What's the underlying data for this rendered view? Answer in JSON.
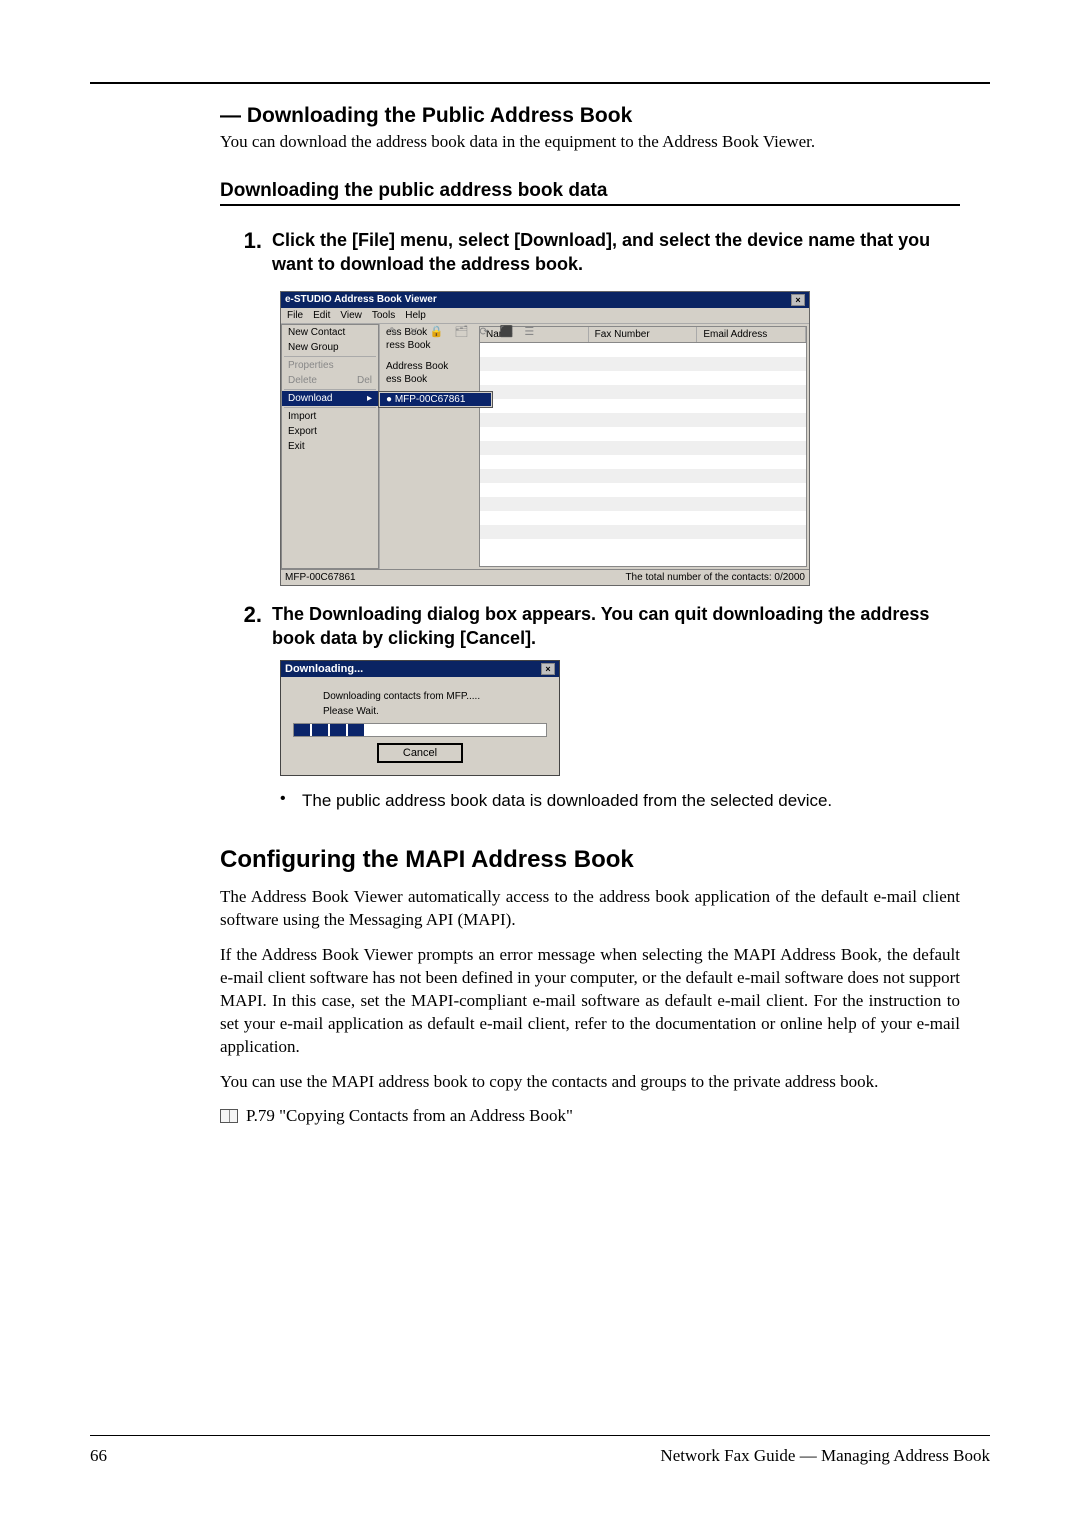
{
  "rule": true,
  "section1": {
    "title": "— Downloading the Public Address Book",
    "intro": "You can download the address book data in the equipment to the Address Book Viewer.",
    "sub": "Downloading the public address book data"
  },
  "steps": {
    "s1": {
      "num": "1.",
      "text": "Click the [File] menu, select [Download], and select the device name that you want to download the address book."
    },
    "s2": {
      "num": "2.",
      "text": "The Downloading dialog box appears.  You can quit downloading the address book data by clicking [Cancel]."
    }
  },
  "appWindow": {
    "title": "e-STUDIO Address Book Viewer",
    "close": "×",
    "menubar": {
      "file": "File",
      "edit": "Edit",
      "view": "View",
      "tools": "Tools",
      "help": "Help"
    },
    "fileMenu": {
      "newContact": "New Contact",
      "newGroup": "New Group",
      "properties": "Properties",
      "delete": "Delete",
      "deleteKey": "Del",
      "download": "Download",
      "arrow": "▸",
      "import": "Import",
      "export": "Export",
      "exit": "Exit"
    },
    "subMenu": {
      "device": "● MFP-00C67861"
    },
    "treePane": {
      "a": "ess Book",
      "b": "ress Book",
      "c": "Address Book",
      "d": "ess Book"
    },
    "columns": {
      "name": "Name",
      "fax": "Fax Number",
      "email": "Email Address"
    },
    "status": {
      "device": "MFP-00C67861",
      "total": "The total number of the contacts: 0/2000"
    },
    "toolbar": "✎ ✕ 🔒 🗂 ⟳ ⬛ ☰"
  },
  "dialog": {
    "title": "Downloading...",
    "close": "×",
    "line1": "Downloading contacts from MFP.....",
    "line2": "Please Wait.",
    "btn": "Cancel"
  },
  "bullet": {
    "text": "The public address book data is downloaded from the selected device."
  },
  "section2": {
    "title": "Configuring the MAPI Address Book",
    "p1": "The Address Book Viewer automatically access to the address book application of the default e-mail client software using the Messaging API (MAPI).",
    "p2": "If the Address Book Viewer prompts an error message when selecting the MAPI Address Book, the default e-mail client software has not been defined in your computer, or the default e-mail software does not support MAPI.  In this case, set the MAPI-compliant e-mail software as default e-mail client.  For the instruction to set your e-mail application as default e-mail client, refer to the documentation or online help of your e-mail application.",
    "p3": "You can use the MAPI address book to copy the contacts and groups to the private address book.",
    "linkText": "P.79 \"Copying Contacts from an Address Book\""
  },
  "footer": {
    "page": "66",
    "right": "Network Fax Guide — Managing Address Book"
  }
}
